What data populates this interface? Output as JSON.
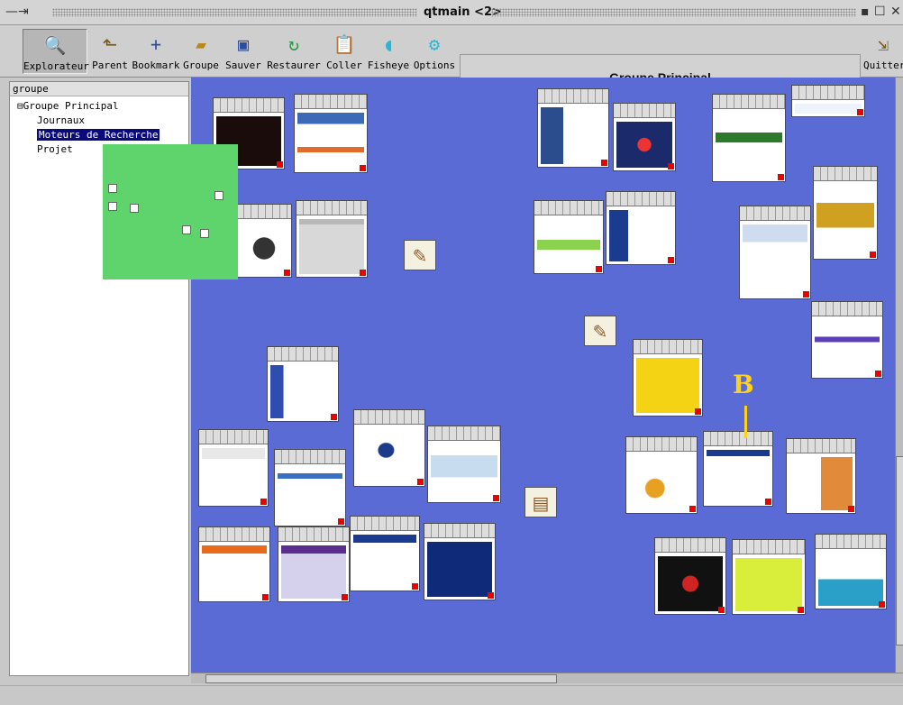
{
  "window": {
    "title": "qtmain <2>"
  },
  "toolbar": {
    "buttons": [
      {
        "label": "Explorateur",
        "icon": "explorer-icon"
      },
      {
        "label": "Parent",
        "icon": "parent-icon"
      },
      {
        "label": "Bookmark",
        "icon": "bookmark-icon"
      },
      {
        "label": "Groupe",
        "icon": "group-icon"
      },
      {
        "label": "Sauver",
        "icon": "save-icon"
      },
      {
        "label": "Restaurer",
        "icon": "restore-icon"
      },
      {
        "label": "Coller",
        "icon": "paste-icon"
      },
      {
        "label": "Fisheye",
        "icon": "fisheye-icon"
      },
      {
        "label": "Options",
        "icon": "options-icon"
      }
    ],
    "group_title": "Groupe Principal",
    "quit_label": "Quitter"
  },
  "tree": {
    "header": "groupe",
    "root": "Groupe Principal",
    "items": [
      "Journaux",
      "Moteurs de Recherche",
      "Projet"
    ],
    "selected": "Moteurs de Recherche"
  },
  "canvas": {
    "background_color": "#5a6bd6",
    "minimap_color": "#5fd46d",
    "marker_label": "B",
    "marker_color": "#ffd21a"
  }
}
